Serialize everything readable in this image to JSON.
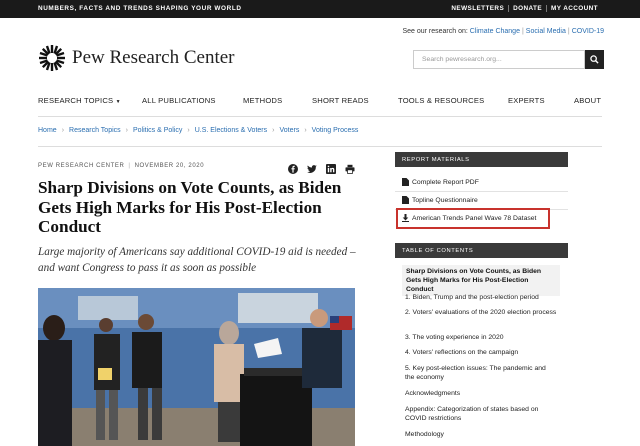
{
  "topbar": {
    "tagline": "NUMBERS, FACTS AND TRENDS SHAPING YOUR WORLD",
    "links": [
      "NEWSLETTERS",
      "DONATE",
      "MY ACCOUNT"
    ]
  },
  "brand": {
    "name": "Pew Research Center"
  },
  "research_on": {
    "label": "See our research on:",
    "links": [
      "Climate Change",
      "Social Media",
      "COVID-19"
    ]
  },
  "search": {
    "placeholder": "Search pewresearch.org..."
  },
  "nav": {
    "items": [
      "RESEARCH TOPICS",
      "ALL PUBLICATIONS",
      "METHODS",
      "SHORT READS",
      "TOOLS & RESOURCES",
      "EXPERTS",
      "ABOUT"
    ]
  },
  "breadcrumb": [
    "Home",
    "Research Topics",
    "Politics & Policy",
    "U.S. Elections & Voters",
    "Voters",
    "Voting Process"
  ],
  "article": {
    "source": "PEW RESEARCH CENTER",
    "date": "NOVEMBER 20, 2020",
    "headline": "Sharp Divisions on Vote Counts, as Biden Gets High Marks for His Post-Election Conduct",
    "dek": "Large majority of Americans say additional COVID-19 aid is needed – and want Congress to pass it as soon as possible"
  },
  "report_materials": {
    "heading": "REPORT MATERIALS",
    "items": [
      "Complete Report PDF",
      "Topline Questionnaire",
      "American Trends Panel Wave 78 Dataset"
    ]
  },
  "toc": {
    "heading": "TABLE OF CONTENTS",
    "current": "Sharp Divisions on Vote Counts, as Biden Gets High Marks for His Post-Election Conduct",
    "items": [
      "1. Biden, Trump and the post-election period",
      "2. Voters' evaluations of the 2020 election process",
      "3. The voting experience in 2020",
      "4. Voters' reflections on the campaign",
      "5. Key post-election issues: The pandemic and the economy",
      "Acknowledgments",
      "Appendix: Categorization of states based on COVID restrictions",
      "Methodology"
    ]
  },
  "colors": {
    "link": "#2a6eb0",
    "topbar": "#1a1a1a",
    "highlight": "#c8332d",
    "panel_header": "#3a3a3a"
  }
}
